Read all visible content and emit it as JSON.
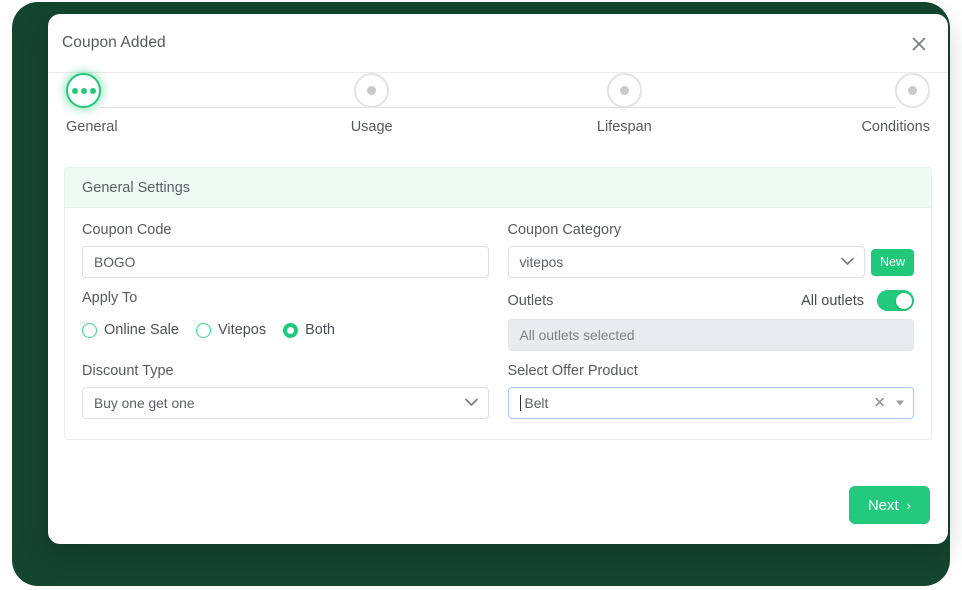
{
  "modal": {
    "title": "Coupon Added",
    "close_icon": "close-icon"
  },
  "stepper": {
    "steps": [
      {
        "label": "General",
        "state": "active"
      },
      {
        "label": "Usage",
        "state": "inactive"
      },
      {
        "label": "Lifespan",
        "state": "inactive"
      },
      {
        "label": "Conditions",
        "state": "inactive"
      }
    ]
  },
  "section": {
    "title": "General Settings"
  },
  "fields": {
    "coupon_code": {
      "label": "Coupon Code",
      "value": "BOGO",
      "placeholder": "Coupon Code"
    },
    "coupon_category": {
      "label": "Coupon Category",
      "value": "vitepos",
      "new_button": "New"
    },
    "apply_to": {
      "label": "Apply To",
      "options": [
        {
          "label": "Online Sale",
          "selected": false
        },
        {
          "label": "Vitepos",
          "selected": false
        },
        {
          "label": "Both",
          "selected": true
        }
      ]
    },
    "outlets": {
      "label": "Outlets",
      "toggle_label": "All outlets",
      "toggle_on": true,
      "value": "All outlets selected"
    },
    "discount_type": {
      "label": "Discount Type",
      "value": "Buy one get one"
    },
    "offer_product": {
      "label": "Select Offer Product",
      "value": "Belt",
      "clear_icon": "clear-icon",
      "dropdown_icon": "caret-down-icon"
    }
  },
  "footer": {
    "next_label": "Next",
    "next_chevron": "›"
  },
  "colors": {
    "accent_green": "#23c97d",
    "backdrop_green": "#14452f",
    "section_bg": "#effaf4",
    "focus_blue": "#a9c8ee"
  }
}
